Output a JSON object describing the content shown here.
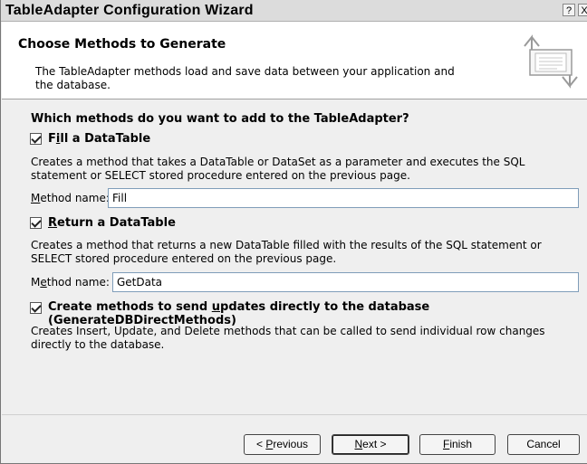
{
  "window": {
    "title": "TableAdapter Configuration Wizard",
    "help_glyph": "?",
    "close_glyph": "X"
  },
  "header": {
    "title": "Choose Methods to Generate",
    "subtitle": "The TableAdapter methods load and save data between your application and the database.",
    "icon": "database-arrows-icon"
  },
  "main": {
    "question": "Which methods do you want to add to the TableAdapter?",
    "fill": {
      "checked": true,
      "label_mnemonic": "i",
      "label_pre": "F",
      "label_post": "ll a DataTable",
      "description": "Creates a method that takes a DataTable or DataSet as a parameter and executes the SQL statement or SELECT stored procedure entered on the previous page.",
      "method_label_mnemonic": "M",
      "method_label_rest": "ethod name:",
      "method_value": "Fill"
    },
    "return": {
      "checked": true,
      "label_mnemonic": "R",
      "label_rest": "eturn a DataTable",
      "description": "Creates a method that returns a new DataTable filled with the results of the SQL statement or SELECT stored procedure entered on the previous page.",
      "method_label_pre": "M",
      "method_label_mnemonic": "e",
      "method_label_rest": "thod name:",
      "method_value": "GetData"
    },
    "updates": {
      "checked": true,
      "label_pre": "Create methods to send ",
      "label_mnemonic": "u",
      "label_post": "pdates directly to the database (GenerateDBDirectMethods)",
      "description": "Creates Insert, Update, and Delete methods that can be called to send individual row changes directly to the database."
    }
  },
  "footer": {
    "previous_pre": "< ",
    "previous_mnemonic": "P",
    "previous_rest": "revious",
    "next_mnemonic": "N",
    "next_rest": "ext >",
    "finish_mnemonic": "F",
    "finish_rest": "inish",
    "cancel": "Cancel"
  }
}
